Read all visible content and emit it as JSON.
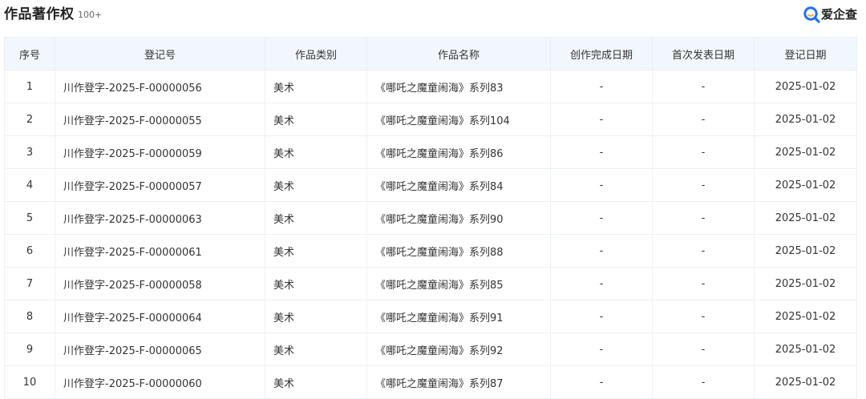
{
  "header": {
    "title": "作品著作权",
    "count": "100+",
    "brand_name": "爱企查",
    "brand_icon": "magnifier-logo-icon",
    "brand_color": "#1e6fff"
  },
  "table": {
    "columns": [
      "序号",
      "登记号",
      "作品类别",
      "作品名称",
      "创作完成日期",
      "首次发表日期",
      "登记日期"
    ],
    "rows": [
      {
        "idx": "1",
        "reg": "川作登字-2025-F-00000056",
        "cat": "美术",
        "name": "《哪吒之魔童闹海》系列83",
        "done": "-",
        "pub": "-",
        "date": "2025-01-02"
      },
      {
        "idx": "2",
        "reg": "川作登字-2025-F-00000055",
        "cat": "美术",
        "name": "《哪吒之魔童闹海》系列104",
        "done": "-",
        "pub": "-",
        "date": "2025-01-02"
      },
      {
        "idx": "3",
        "reg": "川作登字-2025-F-00000059",
        "cat": "美术",
        "name": "《哪吒之魔童闹海》系列86",
        "done": "-",
        "pub": "-",
        "date": "2025-01-02"
      },
      {
        "idx": "4",
        "reg": "川作登字-2025-F-00000057",
        "cat": "美术",
        "name": "《哪吒之魔童闹海》系列84",
        "done": "-",
        "pub": "-",
        "date": "2025-01-02"
      },
      {
        "idx": "5",
        "reg": "川作登字-2025-F-00000063",
        "cat": "美术",
        "name": "《哪吒之魔童闹海》系列90",
        "done": "-",
        "pub": "-",
        "date": "2025-01-02"
      },
      {
        "idx": "6",
        "reg": "川作登字-2025-F-00000061",
        "cat": "美术",
        "name": "《哪吒之魔童闹海》系列88",
        "done": "-",
        "pub": "-",
        "date": "2025-01-02"
      },
      {
        "idx": "7",
        "reg": "川作登字-2025-F-00000058",
        "cat": "美术",
        "name": "《哪吒之魔童闹海》系列85",
        "done": "-",
        "pub": "-",
        "date": "2025-01-02"
      },
      {
        "idx": "8",
        "reg": "川作登字-2025-F-00000064",
        "cat": "美术",
        "name": "《哪吒之魔童闹海》系列91",
        "done": "-",
        "pub": "-",
        "date": "2025-01-02"
      },
      {
        "idx": "9",
        "reg": "川作登字-2025-F-00000065",
        "cat": "美术",
        "name": "《哪吒之魔童闹海》系列92",
        "done": "-",
        "pub": "-",
        "date": "2025-01-02"
      },
      {
        "idx": "10",
        "reg": "川作登字-2025-F-00000060",
        "cat": "美术",
        "name": "《哪吒之魔童闹海》系列87",
        "done": "-",
        "pub": "-",
        "date": "2025-01-02"
      }
    ]
  }
}
